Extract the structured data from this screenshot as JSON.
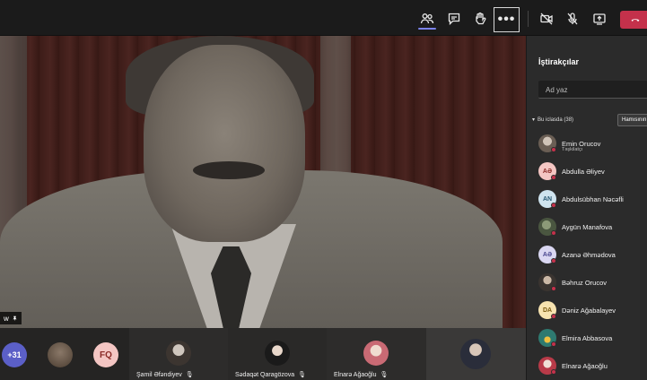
{
  "toolbar": {
    "participants_icon": "people-icon",
    "chat_icon": "chat-icon",
    "raise_hand_icon": "hand-icon",
    "more_label": "•••",
    "camera_icon": "camera-off-icon",
    "mic_icon": "mic-off-icon",
    "share_icon": "share-tray-icon",
    "hangup_icon": "phone-hangup-icon",
    "colors": {
      "accent": "#7b83eb",
      "hangup": "#c4314b"
    }
  },
  "main_video": {
    "speaker_tag": "w"
  },
  "strip": {
    "overflow_count": "+31",
    "fq_initials": "FQ",
    "tiles": [
      {
        "name": "Şamil Əfəndiyev"
      },
      {
        "name": "Sədaqət Qaragözova"
      },
      {
        "name": "Elnarə Ağaoğlu"
      },
      {
        "name": ""
      }
    ]
  },
  "panel": {
    "title": "İştirakçılar",
    "search_placeholder": "Ad yaz",
    "section_label": "Bu iclasda (38)",
    "mute_all_label": "Hamısının səsini söndür",
    "participants": [
      {
        "name": "Emin Orucov",
        "role": "Təşkilatçı",
        "initials": "",
        "color": "#8a7c70",
        "photo": true
      },
      {
        "name": "Abdulla Əliyev",
        "initials": "AƏ",
        "color": "#f4c6c3",
        "text": "#8a2a26"
      },
      {
        "name": "Abdulsübhan Nəcəfli",
        "initials": "AN",
        "color": "#cfe4ef",
        "text": "#2a5a74"
      },
      {
        "name": "Aygün Manafova",
        "initials": "",
        "color": "#6b7a60",
        "photo": true
      },
      {
        "name": "Azanə Əhmədova",
        "initials": "AƏ",
        "color": "#dad7f2",
        "text": "#4a4790"
      },
      {
        "name": "Bəhruz Orucov",
        "initials": "",
        "color": "#7a6a5a",
        "photo": true
      },
      {
        "name": "Dəniz Ağabalayev",
        "initials": "DA",
        "color": "#f7e3b0",
        "text": "#7a5a10"
      },
      {
        "name": "Elmira Abbasova",
        "initials": "",
        "color": "#3a7a70",
        "photo": true
      },
      {
        "name": "Elnarə Ağaoğlu",
        "initials": "",
        "color": "#c8b0a8",
        "photo": true
      }
    ]
  }
}
